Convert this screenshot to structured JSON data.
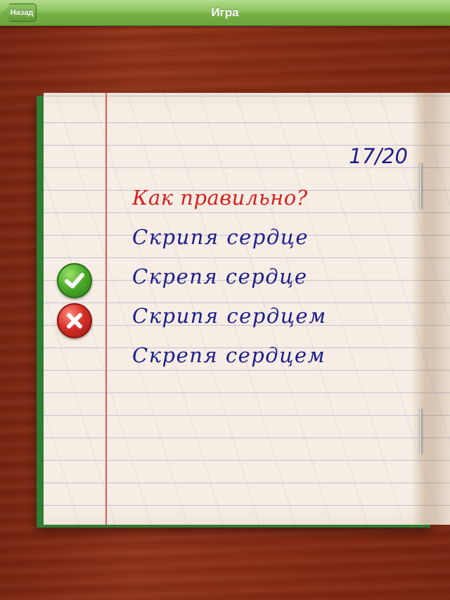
{
  "navbar": {
    "back_label": "Назад",
    "title": "Игра"
  },
  "game": {
    "progress": "17/20",
    "question": "Как правильно?",
    "answers": [
      {
        "text": "Скрипя сердце",
        "mark": "none"
      },
      {
        "text": "Скрепя сердце",
        "mark": "correct"
      },
      {
        "text": "Скрипя сердцем",
        "mark": "wrong"
      },
      {
        "text": "Скрепя сердцем",
        "mark": "none"
      }
    ]
  },
  "icons": {
    "correct": "checkmark-icon",
    "wrong": "cross-icon"
  },
  "colors": {
    "navbar": "#76b145",
    "question": "#d82020",
    "answers": "#1c1c8c",
    "correct": "#4cae2b",
    "wrong": "#d8322a",
    "margin_line": "#e0545d"
  }
}
